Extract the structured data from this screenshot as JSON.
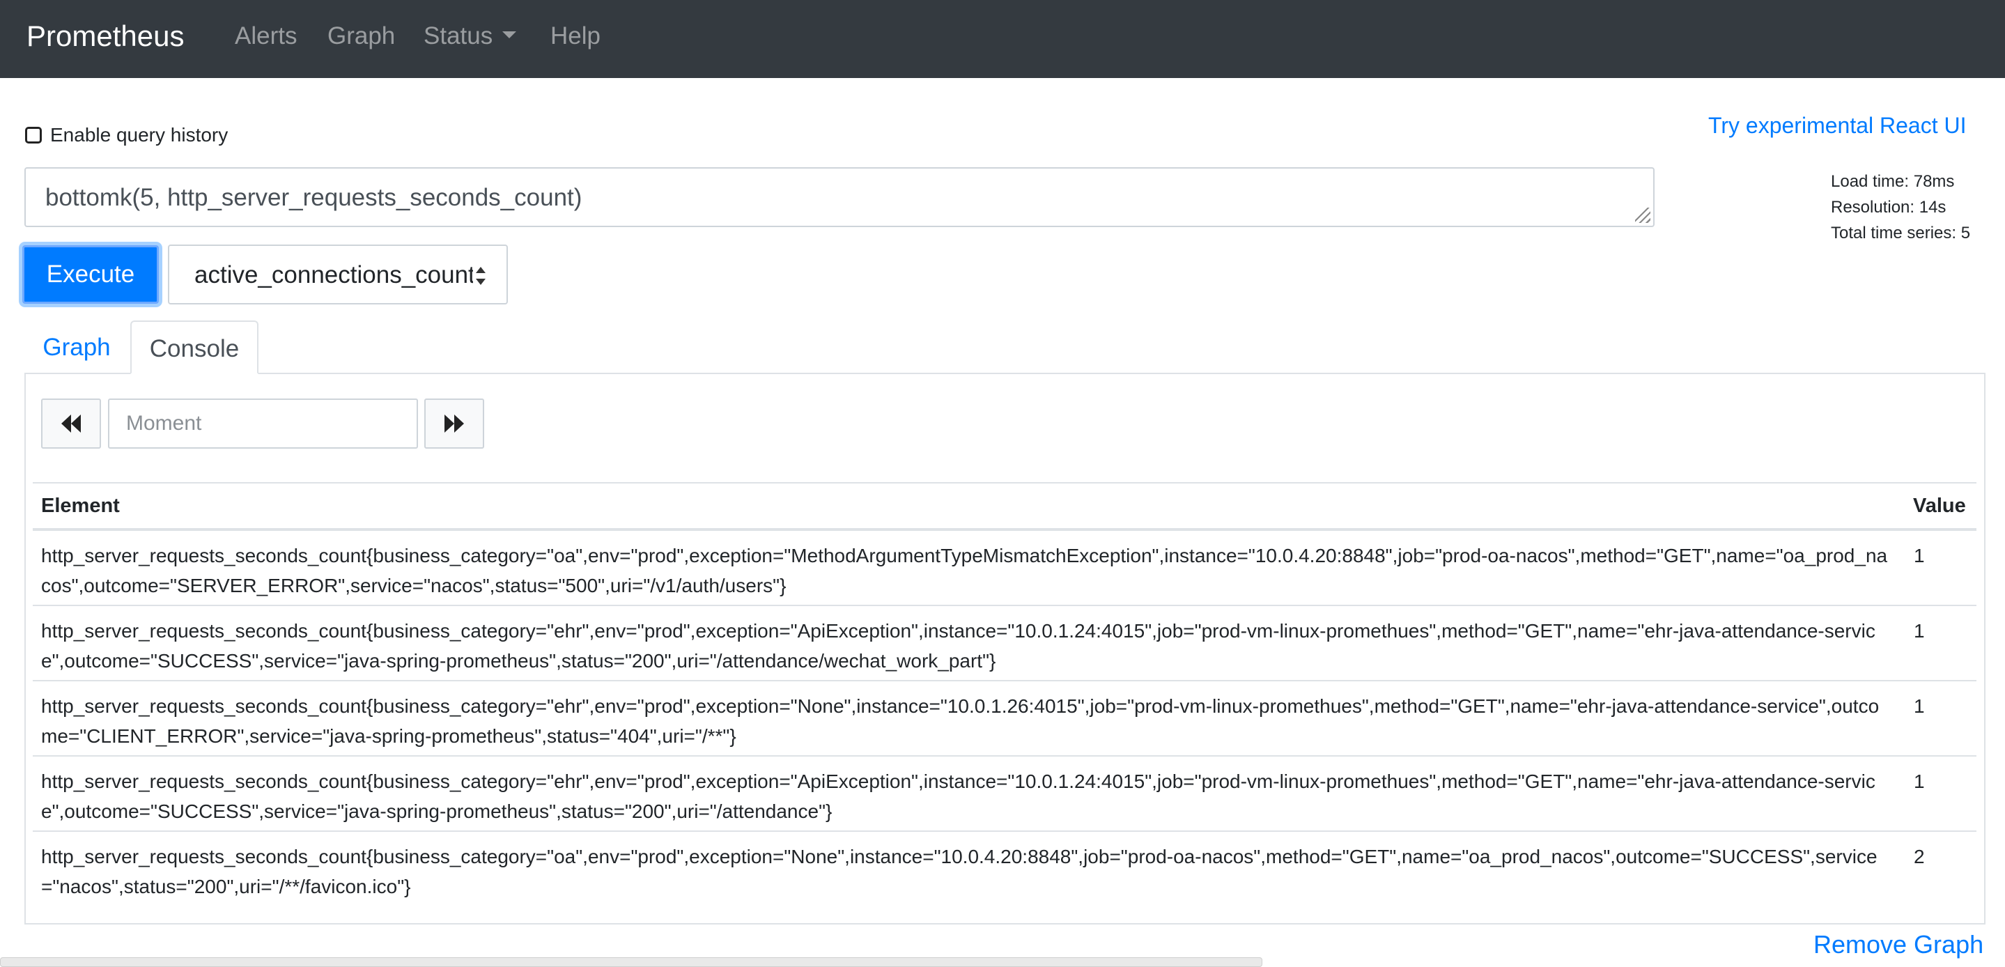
{
  "navbar": {
    "brand": "Prometheus",
    "links": [
      "Alerts",
      "Graph",
      "Status",
      "Help"
    ]
  },
  "query": {
    "history_label": "Enable query history",
    "history_checked": false,
    "react_link": "Try experimental React UI",
    "expression": "bottomk(5, http_server_requests_seconds_count)",
    "execute_label": "Execute",
    "metric_select_value": "active_connections_count"
  },
  "stats": {
    "load_time": "Load time: 78ms",
    "resolution": "Resolution: 14s",
    "total_series": "Total time series: 5"
  },
  "tabs": {
    "graph": "Graph",
    "console": "Console",
    "active": "Console"
  },
  "console": {
    "moment_placeholder": "Moment",
    "prev_icon": "fast-backward-icon",
    "next_icon": "fast-forward-icon",
    "headers": {
      "element": "Element",
      "value": "Value"
    },
    "rows": [
      {
        "element": "http_server_requests_seconds_count{business_category=\"oa\",env=\"prod\",exception=\"MethodArgumentTypeMismatchException\",instance=\"10.0.4.20:8848\",job=\"prod-oa-nacos\",method=\"GET\",name=\"oa_prod_nacos\",outcome=\"SERVER_ERROR\",service=\"nacos\",status=\"500\",uri=\"/v1/auth/users\"}",
        "value": "1"
      },
      {
        "element": "http_server_requests_seconds_count{business_category=\"ehr\",env=\"prod\",exception=\"ApiException\",instance=\"10.0.1.24:4015\",job=\"prod-vm-linux-promethues\",method=\"GET\",name=\"ehr-java-attendance-service\",outcome=\"SUCCESS\",service=\"java-spring-prometheus\",status=\"200\",uri=\"/attendance/wechat_work_part\"}",
        "value": "1"
      },
      {
        "element": "http_server_requests_seconds_count{business_category=\"ehr\",env=\"prod\",exception=\"None\",instance=\"10.0.1.26:4015\",job=\"prod-vm-linux-promethues\",method=\"GET\",name=\"ehr-java-attendance-service\",outcome=\"CLIENT_ERROR\",service=\"java-spring-prometheus\",status=\"404\",uri=\"/**\"}",
        "value": "1"
      },
      {
        "element": "http_server_requests_seconds_count{business_category=\"ehr\",env=\"prod\",exception=\"ApiException\",instance=\"10.0.1.24:4015\",job=\"prod-vm-linux-promethues\",method=\"GET\",name=\"ehr-java-attendance-service\",outcome=\"SUCCESS\",service=\"java-spring-prometheus\",status=\"200\",uri=\"/attendance\"}",
        "value": "1"
      },
      {
        "element": "http_server_requests_seconds_count{business_category=\"oa\",env=\"prod\",exception=\"None\",instance=\"10.0.4.20:8848\",job=\"prod-oa-nacos\",method=\"GET\",name=\"oa_prod_nacos\",outcome=\"SUCCESS\",service=\"nacos\",status=\"200\",uri=\"/**/favicon.ico\"}",
        "value": "2"
      }
    ]
  },
  "remove_graph": "Remove Graph",
  "colors": {
    "navbar": "#343a40",
    "primary": "#007bff",
    "border": "#dee2e6"
  }
}
